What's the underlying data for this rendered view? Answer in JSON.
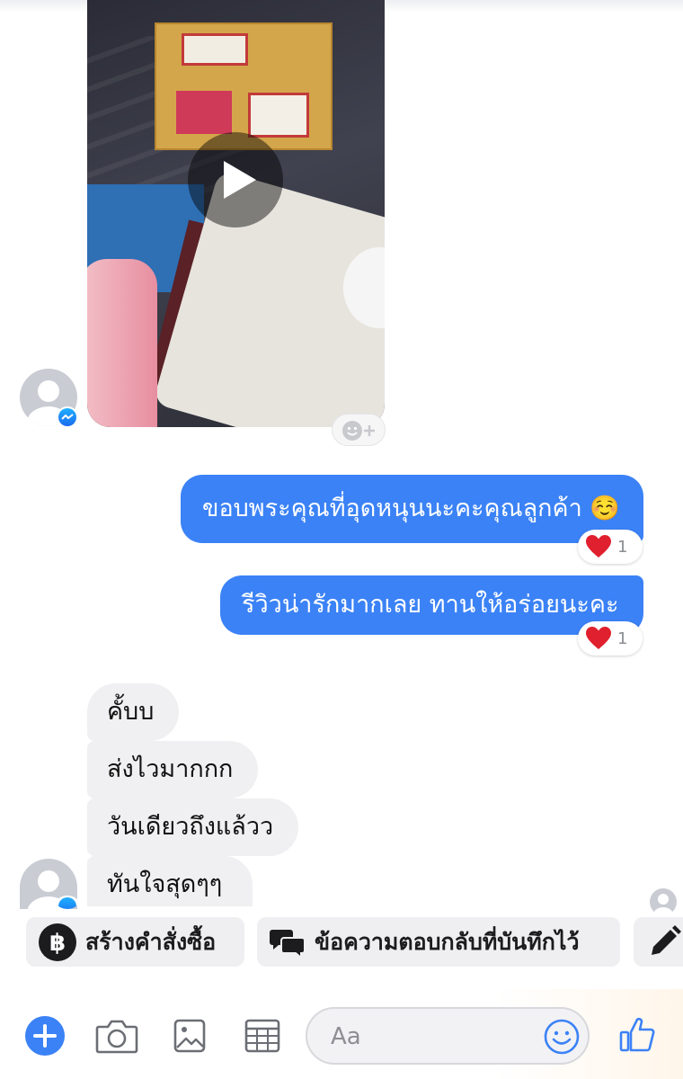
{
  "messages_out": [
    {
      "text": "ขอบพระคุณที่อุดหนุนนะคะคุณลูกค้า ☺️",
      "reaction_count": "1"
    },
    {
      "text": "รีวิวน่ารักมากเลย ทานให้อร่อยนะคะ",
      "reaction_count": "1"
    }
  ],
  "messages_in": [
    {
      "text": "คั้บบ"
    },
    {
      "text": "ส่งไวมากกก"
    },
    {
      "text": "วันเดียวถึงแล้วว"
    },
    {
      "text": "ทันใจสุดๆๆ"
    }
  ],
  "quick_actions": {
    "create_order": "สร้างคำสั่งซื้อ",
    "saved_replies": "ข้อความตอบกลับที่บันทึกไว้"
  },
  "composer": {
    "placeholder": "Aa"
  },
  "icons": {
    "play": "play-icon",
    "add_reaction": "add-reaction-icon",
    "heart": "heart-icon",
    "baht": "baht-icon",
    "chat_bubbles": "chat-bubbles-icon",
    "pencil": "pencil-icon",
    "plus": "plus-circle-icon",
    "camera": "camera-icon",
    "image": "image-icon",
    "grid": "grid-icon",
    "emoji": "emoji-icon",
    "like": "like-icon"
  },
  "colors": {
    "accent": "#3b82f6",
    "bubble_in": "#f0f0f2",
    "heart": "#e0202e"
  }
}
